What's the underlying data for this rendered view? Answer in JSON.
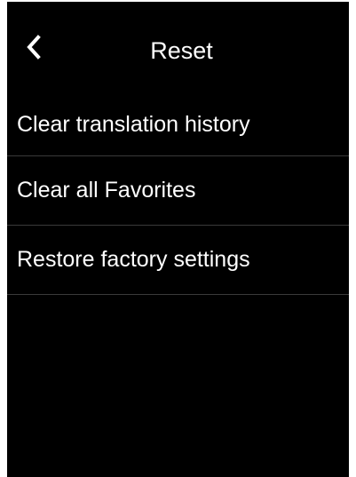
{
  "header": {
    "title": "Reset",
    "back_icon": "chevron-left-icon"
  },
  "menu": {
    "items": [
      {
        "label": "Clear translation history"
      },
      {
        "label": "Clear all Favorites"
      },
      {
        "label": "Restore factory settings"
      }
    ]
  },
  "colors": {
    "background": "#000000",
    "text": "#ffffff",
    "divider": "#3a3a3a"
  }
}
